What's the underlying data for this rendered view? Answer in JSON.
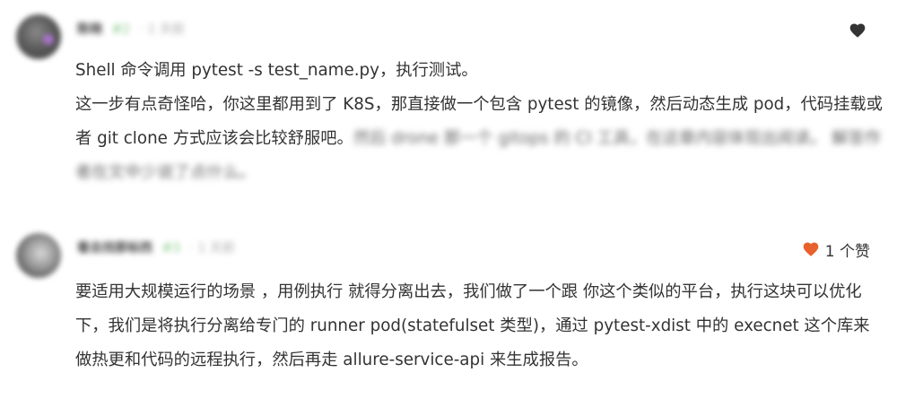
{
  "comments": [
    {
      "header": {
        "name": "陈晓",
        "level": "#2",
        "time": "· 1 天前"
      },
      "like_icon": "heart-icon",
      "like_color": "#333333",
      "paragraphs": [
        "Shell 命令调用 pytest -s test_name.py，执行测试。",
        "这一步有点奇怪哈，你这里都用到了 K8S，那直接做一个包含 pytest 的镜像，然后动态生成 pod，代码挂载或者 git clone 方式应该会比较舒服吧。"
      ],
      "blurred_tail": "然后 drone 那一个 gitops 的 CI 工具，在这章内容体现出阅读。 解答作者在文中少说了点什么。"
    },
    {
      "header": {
        "name": "看去找那标西",
        "level": "#3",
        "time": "· 1 天前"
      },
      "like_icon": "heart-icon",
      "like_color": "#e8612c",
      "like_text": "1 个赞",
      "paragraphs": [
        "要适用大规模运行的场景 ，用例执行 就得分离出去，我们做了一个跟 你这个类似的平台，执行这块可以优化下，我们是将执行分离给专门的 runner pod(statefulset 类型)，通过 pytest-xdist 中的 execnet 这个库来做热更和代码的远程执行，然后再走 allure-service-api 来生成报告。"
      ]
    }
  ]
}
